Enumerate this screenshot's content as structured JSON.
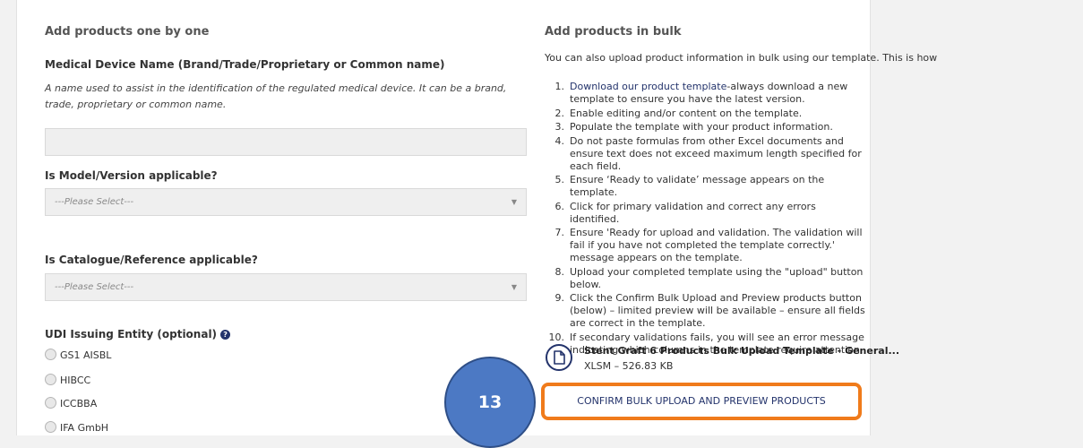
{
  "left": {
    "section_title": "Add products one by one",
    "device_name": {
      "label": "Medical Device Name (Brand/Trade/Proprietary or Common name)",
      "description": "A name used to assist in the identification of the regulated medical device. It can be a brand, trade, proprietary or common name.",
      "value": ""
    },
    "model_version": {
      "label": "Is Model/Version applicable?",
      "selected": "---Please Select---"
    },
    "catalogue": {
      "label": "Is Catalogue/Reference applicable?",
      "selected": "---Please Select---"
    },
    "udi": {
      "label": "UDI Issuing Entity (optional)",
      "options": [
        "GS1 AISBL",
        "HIBCC",
        "ICCBBA",
        "IFA GmbH"
      ]
    }
  },
  "right": {
    "section_title": "Add products in bulk",
    "intro": "You can also upload product information in bulk using our template. This is how",
    "steps": [
      {
        "num": "1.",
        "link": "Download our product template",
        "text": "-always download a new template to ensure you have the latest version."
      },
      {
        "num": "2.",
        "text": "Enable editing and/or content on the template."
      },
      {
        "num": "3.",
        "text": "Populate the template with your product information."
      },
      {
        "num": "4.",
        "text": "Do not paste formulas from other Excel documents and ensure text does not exceed maximum length specified for each field."
      },
      {
        "num": "5.",
        "text": "Ensure ‘Ready to validate’ message appears on the template."
      },
      {
        "num": "6.",
        "text": "Click for primary validation and correct any errors identified."
      },
      {
        "num": "7.",
        "text": "Ensure 'Ready for upload and validation. The validation will fail if you have not completed the template correctly.' message appears on the template."
      },
      {
        "num": "8.",
        "text": "Upload your completed template using the \"upload\" button below."
      },
      {
        "num": "9.",
        "text": "Click the Confirm Bulk Upload and Preview products button (below) – limited preview will be available – ensure all fields are correct in the template."
      },
      {
        "num": "10.",
        "text": "If secondary validations fails, you will see an error message indicating which columns in the template require attention."
      }
    ],
    "file": {
      "name": "Stent Graft 6 Products Bulk Upload Template - General...",
      "meta": "XLSM – 526.83 KB"
    },
    "confirm_label": "CONFIRM BULK UPLOAD AND PREVIEW PRODUCTS"
  },
  "annotation": {
    "marker": "13"
  },
  "icons": {
    "help": "question-circle-icon",
    "file": "file-icon",
    "caret": "caret-down-icon"
  },
  "colors": {
    "accent": "#23336b",
    "highlight": "#f07b1b",
    "marker": "#4c79c4"
  }
}
